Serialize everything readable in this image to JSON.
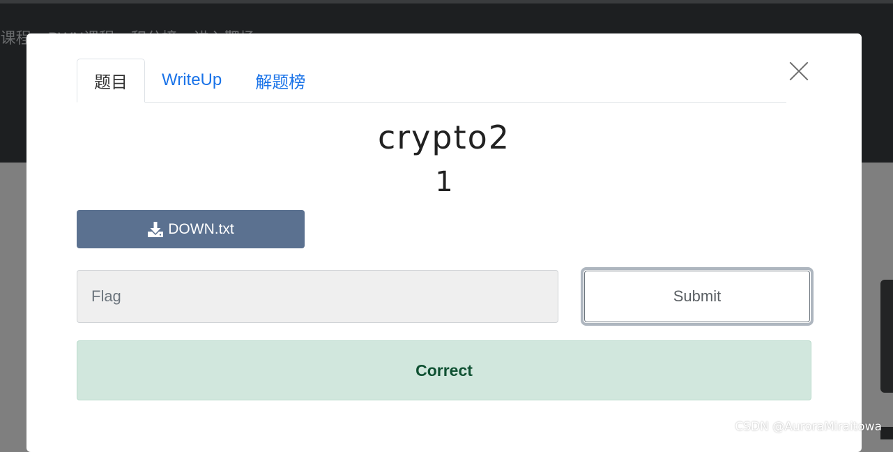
{
  "background_nav": {
    "items": [
      "B课程",
      "PWN课程",
      "积分榜",
      "进入靶场"
    ]
  },
  "modal": {
    "tabs": [
      {
        "label": "题目",
        "active": true
      },
      {
        "label": "WriteUp",
        "active": false
      },
      {
        "label": "解题榜",
        "active": false
      }
    ],
    "close_icon": "close-icon",
    "challenge_name": "crypto2",
    "challenge_value": "1",
    "download": {
      "icon": "download-icon",
      "label": "DOWN.txt"
    },
    "flag_input": {
      "placeholder": "Flag",
      "value": ""
    },
    "submit_label": "Submit",
    "result": {
      "text": "Correct",
      "status": "success"
    }
  },
  "watermark": "CSDN @AuroraMiraitowa",
  "colors": {
    "backdrop": "#7f7f7f",
    "navbar": "#1d1f21",
    "tab_link": "#1a73e8",
    "download_button": "#5b7190",
    "alert_bg": "#d1e7dd",
    "alert_text": "#0f5132"
  }
}
